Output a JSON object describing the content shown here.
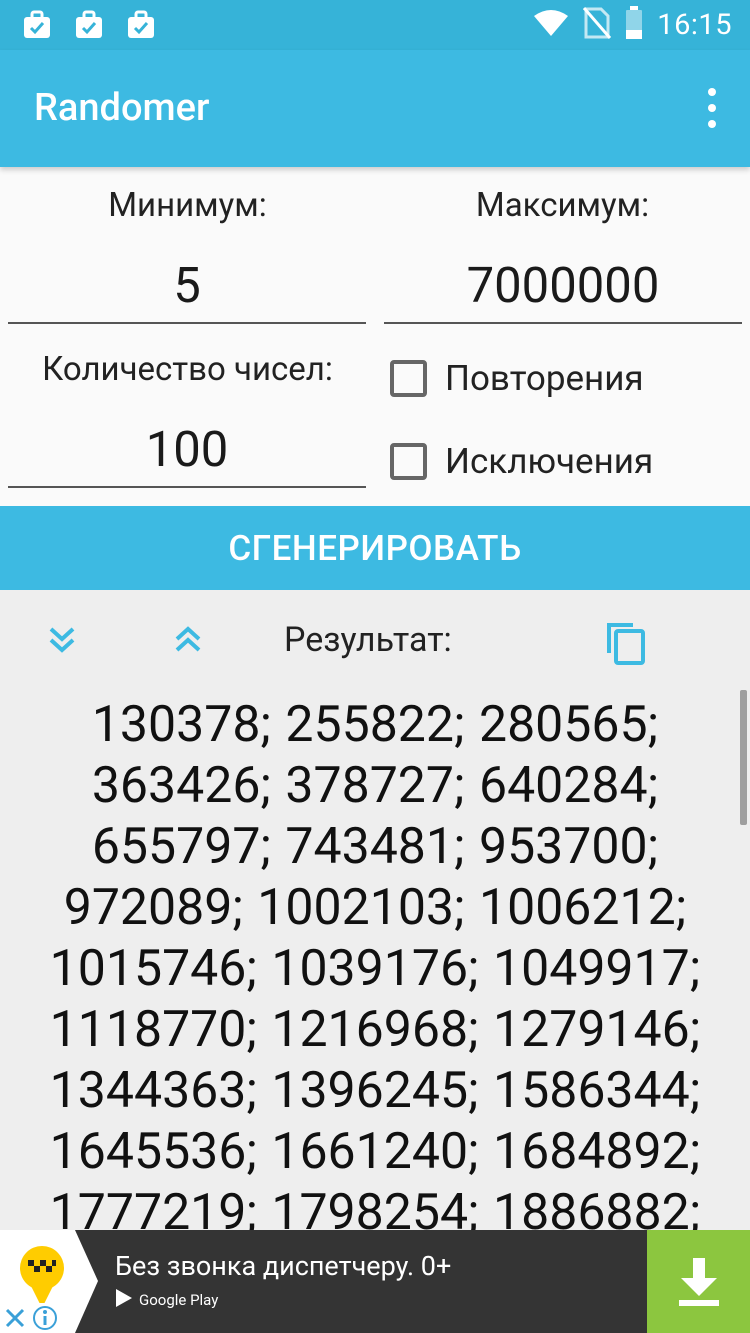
{
  "status_bar": {
    "time": "16:15",
    "notification_icons": [
      "briefcase-check-icon",
      "briefcase-check-icon",
      "briefcase-check-icon"
    ],
    "system_icons": [
      "wifi-icon",
      "no-sim-icon",
      "battery-icon"
    ]
  },
  "app_bar": {
    "title": "Randomer",
    "menu_icon": "more-vert-icon"
  },
  "form": {
    "min_label": "Минимум:",
    "min_value": "5",
    "max_label": "Максимум:",
    "max_value": "7000000",
    "count_label": "Количество чисел:",
    "count_value": "100",
    "repeats_label": "Повторения",
    "repeats_checked": false,
    "exclusions_label": "Исключения",
    "exclusions_checked": false
  },
  "generate_button": {
    "label": "СГЕНЕРИРОВАТЬ"
  },
  "result": {
    "label": "Результат:",
    "expand_icon": "chevron-double-down-icon",
    "collapse_icon": "chevron-double-up-icon",
    "copy_icon": "copy-icon",
    "text": "130378; 255822; 280565; 363426; 378727; 640284; 655797; 743481; 953700; 972089; 1002103; 1006212; 1015746; 1039176; 1049917; 1118770; 1216968; 1279146; 1344363; 1396245; 1586344; 1645536; 1661240; 1684892; 1777219; 1798254; 1886882;"
  },
  "ad": {
    "text": "Без звонка диспетчеру. 0+",
    "store": "Google Play",
    "download_icon": "download-icon",
    "close_icon": "close-icon",
    "info_icon": "info-icon",
    "colors": {
      "banner": "#343434",
      "download": "#8cc63f",
      "logo": "#ffcc00"
    }
  },
  "colors": {
    "accent": "#3dbae2",
    "status_bar": "#36b3d8",
    "icon_blue": "#3dbae2"
  }
}
